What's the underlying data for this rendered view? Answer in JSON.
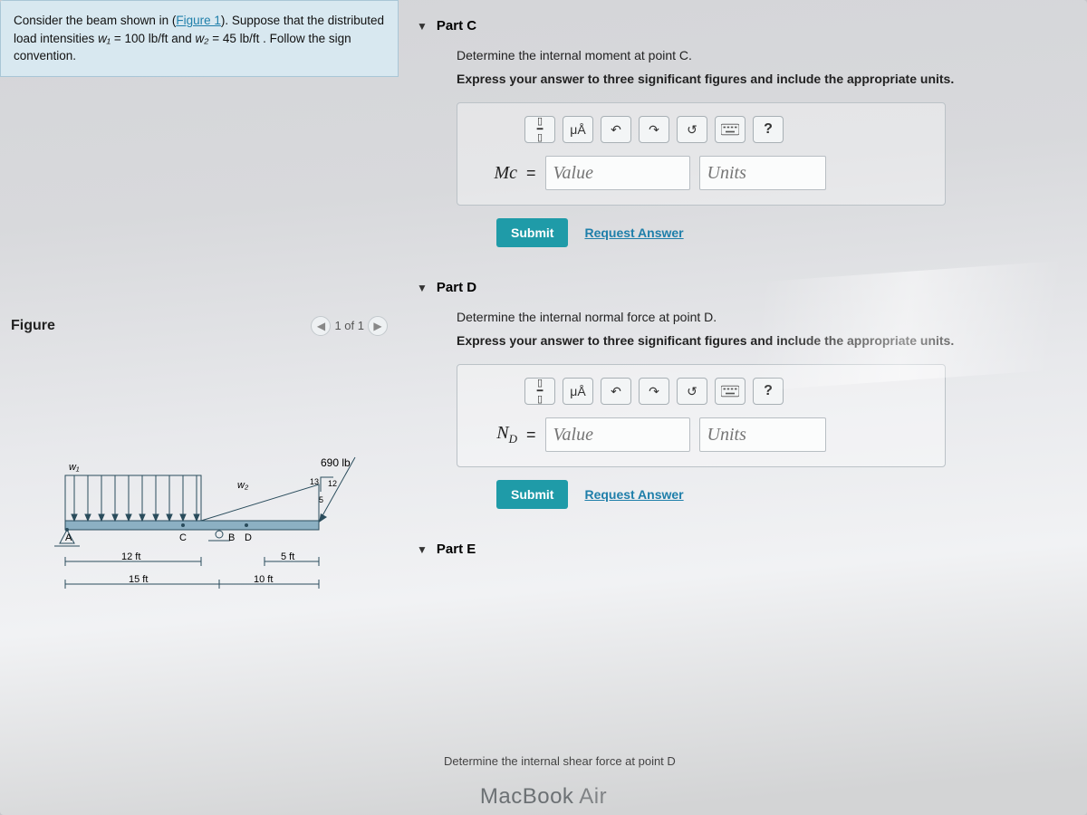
{
  "problem": {
    "text1": "Consider the beam shown in (",
    "figure_link": "Figure 1",
    "text2": "). Suppose that the distributed load intensities ",
    "w1_sym": "w₁",
    "w1_val": " = 100 lb/ft",
    "and": " and ",
    "w2_sym": "w₂",
    "w2_val": " = 45 lb/ft",
    "text3": " . Follow the sign convention."
  },
  "parts": {
    "c": {
      "title": "Part C",
      "instr1": "Determine the internal moment at point C.",
      "instr2": "Express your answer to three significant figures and include the appropriate units.",
      "eq_label": "Mc",
      "value_ph": "Value",
      "units_ph": "Units"
    },
    "d": {
      "title": "Part D",
      "instr1": "Determine the internal normal force at point D.",
      "instr2": "Express your answer to three significant figures and include the appropriate units.",
      "eq_label": "N_D",
      "value_ph": "Value",
      "units_ph": "Units"
    },
    "e": {
      "title": "Part E",
      "instr1": "Determine the internal shear force at point D"
    }
  },
  "buttons": {
    "submit": "Submit",
    "request": "Request Answer",
    "help": "?",
    "units_tool": "μÅ"
  },
  "figure": {
    "title": "Figure",
    "nav": "1 of 1",
    "load_label": "690 lb",
    "ratio_top": "13",
    "ratio_mid": "12",
    "ratio_bot": "5",
    "w1_label": "w₁",
    "w2_label": "w₂",
    "ptA": "A",
    "ptB": "B",
    "ptC": "C",
    "ptD": "D",
    "dim12": "12 ft",
    "dim5": "5 ft",
    "dim15": "15 ft",
    "dim10": "10 ft"
  },
  "device": {
    "brand": "MacBook",
    "model": " Air"
  }
}
